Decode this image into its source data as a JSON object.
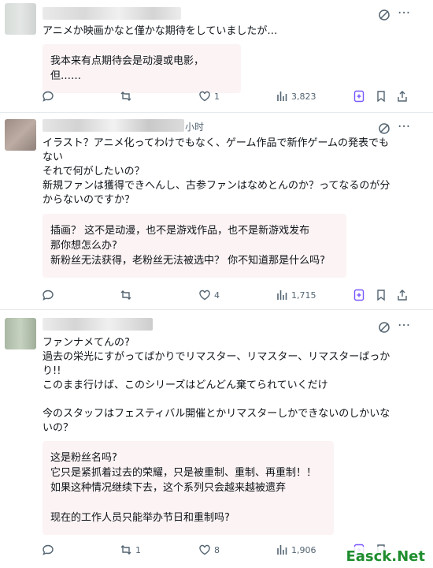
{
  "posts": [
    {
      "header_tail": "",
      "text": "アニメか映画かなと僅かな期待をしていましたが…",
      "translation": "我本来有点期待会是动漫或电影，但……",
      "replies": "",
      "reposts": "",
      "likes": "1",
      "views": "3,823"
    },
    {
      "header_tail": "小时",
      "text": "イラスト？アニメ化ってわけでもなく、ゲーム作品で新作ゲームの発表でも\nない\nそれで何がしたいの？\n新規ファンは獲得できへんし、古参ファンはなめとんのか？ってなるのが分\nからないのですか？",
      "translation": "插画？ 这不是动漫，也不是游戏作品，也不是新游戏发布\n那你想怎么办?\n新粉丝无法获得，老粉丝无法被选中？ 你不知道那是什么吗?",
      "replies": "",
      "reposts": "",
      "likes": "4",
      "views": "1,715"
    },
    {
      "header_tail": "",
      "text": "ファンナメてんの?\n過去の栄光にすがってばかりでリマスター、リマスター、リマスターばっか\nり!!\nこのまま行けば、このシリーズはどんどん棄てられていくだけ\n\n今のスタッフはフェスティバル開催とかリマスターしかできないのしかいな\nいの？",
      "translation": "这是粉丝名吗?\n它只是紧抓着过去的荣耀，只是被重制、重制、再重制！！\n如果这种情况继续下去，这个系列只会越来越被遗弃\n\n现在的工作人员只能举办节日和重制吗?",
      "replies": "",
      "reposts": "1",
      "likes": "8",
      "views": "1,906"
    }
  ],
  "icons": {
    "grok": "grok-icon",
    "more": "more-icon",
    "reply": "reply-icon",
    "repost": "repost-icon",
    "like": "heart-icon",
    "views": "views-icon",
    "grok_action": "grok-action-icon",
    "bookmark": "bookmark-icon",
    "share": "share-icon"
  },
  "colors": {
    "text": "#0f1419",
    "muted": "#536471",
    "translation_bg": "#fbf3f4",
    "grok_accent": "#7856ff",
    "divider": "#e6e9ec"
  },
  "watermark": "Easck.Net"
}
